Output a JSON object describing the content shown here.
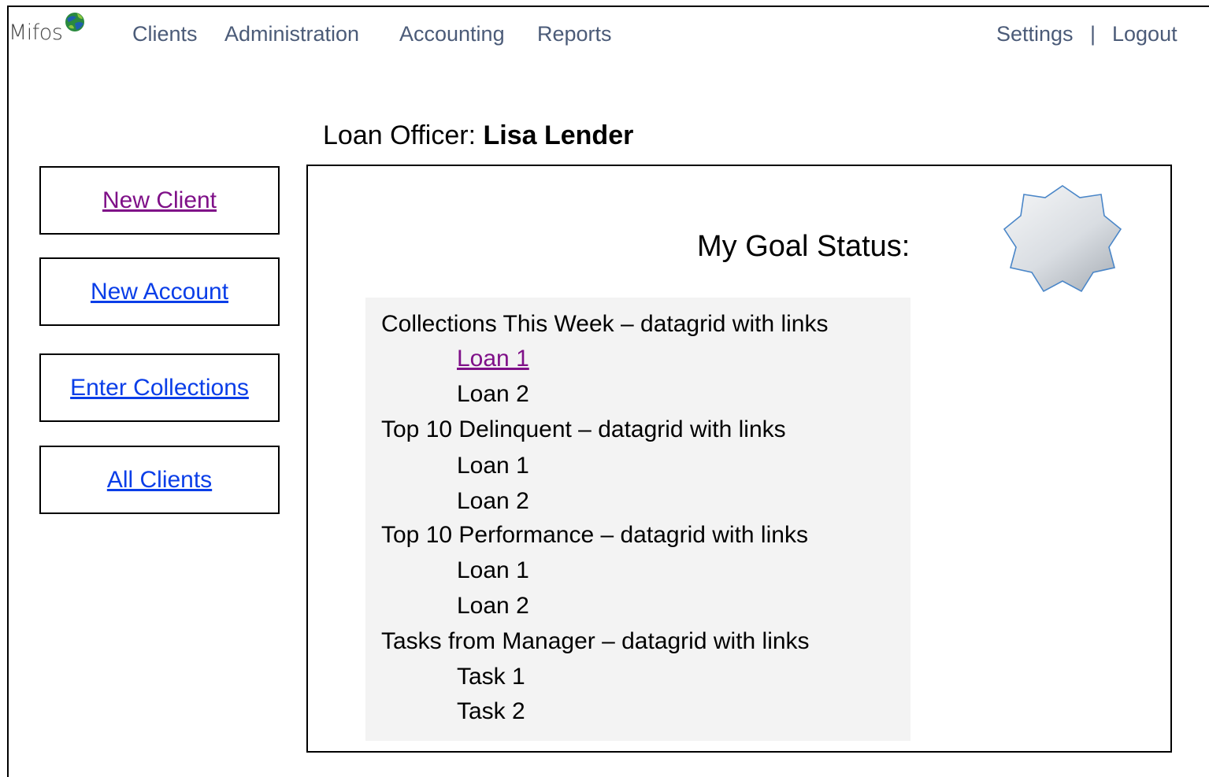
{
  "app": {
    "logo_text": "Mifos",
    "logo_icon": "globe-icon"
  },
  "nav": {
    "clients": "Clients",
    "administration": "Administration",
    "accounting": "Accounting",
    "reports": "Reports",
    "settings": "Settings",
    "separator": "|",
    "logout": "Logout"
  },
  "officer": {
    "label": "Loan Officer: ",
    "name": "Lisa Lender"
  },
  "sidebar": {
    "new_client": "New Client",
    "new_account": "New Account",
    "enter_collections": "Enter Collections",
    "all_clients": "All Clients"
  },
  "colors": {
    "link_blue": "#0a3ee8",
    "link_visited": "#7f1088",
    "nav_text": "#4b5b78",
    "grid_bg": "#f3f3f3",
    "badge_fill": "#d8dde3",
    "badge_stroke": "#4a86c8"
  },
  "goal": {
    "title": "My Goal Status:",
    "badge_icon": "star-badge-icon"
  },
  "sections": [
    {
      "heading": "Collections This Week – datagrid with links",
      "items": [
        "Loan 1",
        "Loan 2"
      ]
    },
    {
      "heading": "Top 10 Delinquent – datagrid with links",
      "items": [
        "Loan 1",
        "Loan 2"
      ]
    },
    {
      "heading": "Top 10 Performance – datagrid with links",
      "items": [
        "Loan 1",
        "Loan 2"
      ]
    },
    {
      "heading": "Tasks from Manager – datagrid with links",
      "items": [
        "Task 1",
        "Task 2"
      ]
    }
  ]
}
